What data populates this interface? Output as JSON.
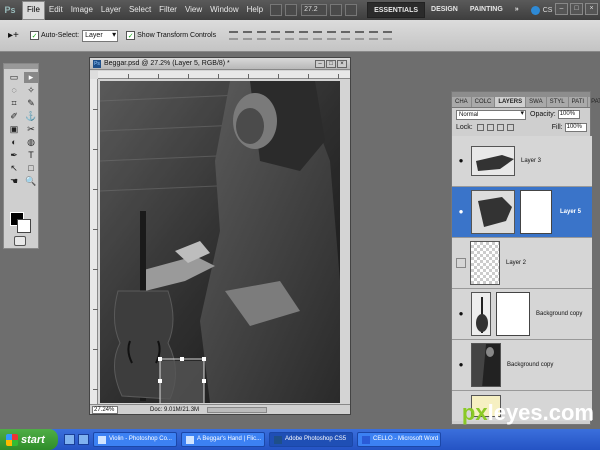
{
  "app": {
    "logo": "Ps",
    "menu": [
      "File",
      "Edit",
      "Image",
      "Layer",
      "Select",
      "Filter",
      "View",
      "Window",
      "Help"
    ],
    "zoom": "27.2",
    "workspaces": [
      "ESSENTIALS",
      "DESIGN",
      "PAINTING"
    ],
    "more": "»",
    "cs_live": "CS Live",
    "window_controls": [
      "–",
      "□",
      "×"
    ]
  },
  "options": {
    "tool_glyph": "▸+",
    "auto_select_label": "Auto-Select:",
    "auto_select_value": "Layer",
    "show_transform_label": "Show Transform Controls"
  },
  "tools": [
    "▭",
    "▸",
    "◌",
    "✧",
    "⌗",
    "✎",
    "✐",
    "⚓",
    "▣",
    "✂",
    "◐",
    "◍",
    "✒",
    "T",
    "↖",
    "□",
    "☚",
    "🔍"
  ],
  "document": {
    "title": "Beggar.psd @ 27.2% (Layer 5, RGB/8) *",
    "zoom": "27.24%",
    "info": "Doc: 9.01M/21.3M",
    "controls": [
      "–",
      "□",
      "×"
    ]
  },
  "layers_panel": {
    "tabs": [
      "CHA",
      "COLC",
      "LAYERS",
      "SWA",
      "STYL",
      "PATI",
      "PAT"
    ],
    "blend_mode": "Normal",
    "opacity_label": "Opacity:",
    "opacity": "100%",
    "lock_label": "Lock:",
    "fill_label": "Fill:",
    "fill": "100%",
    "layers": [
      {
        "name": "Layer 3",
        "visible": true,
        "selected": false
      },
      {
        "name": "Layer 5",
        "visible": true,
        "selected": true
      },
      {
        "name": "Layer 2",
        "visible": false,
        "selected": false
      },
      {
        "name": "Background copy",
        "visible": true,
        "selected": false
      },
      {
        "name": "Background copy",
        "visible": true,
        "selected": false
      }
    ]
  },
  "taskbar": {
    "start": "start",
    "tasks": [
      "Violin - Photoshop Co...",
      "A Beggar's Hand | Flic...",
      "Adobe Photoshop CS5",
      "CELLO - Microsoft Word"
    ]
  },
  "watermark": {
    "prefix": "px",
    "suffix": "leyes.com"
  }
}
